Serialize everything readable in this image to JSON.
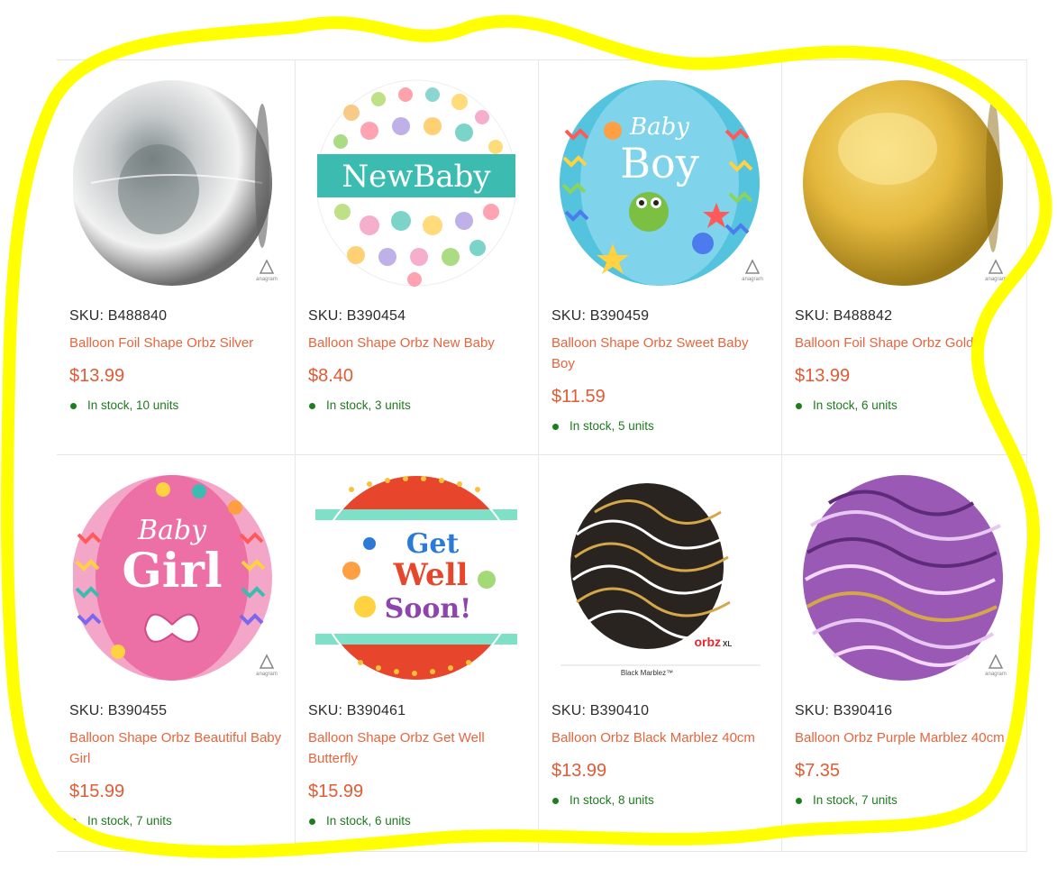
{
  "products": [
    {
      "sku": "SKU: B488840",
      "name": "Balloon Foil Shape Orbz Silver",
      "price": "$13.99",
      "stock": "In stock, 10 units",
      "image": "silver-orb-balloon"
    },
    {
      "sku": "SKU: B390454",
      "name": "Balloon Shape Orbz New Baby",
      "price": "$8.40",
      "stock": "In stock, 3 units",
      "image": "new-baby-orb-balloon",
      "banner": "NewBaby"
    },
    {
      "sku": "SKU: B390459",
      "name": "Balloon Shape Orbz Sweet Baby Boy",
      "price": "$11.59",
      "stock": "In stock, 5 units",
      "image": "baby-boy-orb-balloon",
      "lines": [
        "Baby",
        "Boy"
      ]
    },
    {
      "sku": "SKU: B488842",
      "name": "Balloon Foil Shape Orbz Gold",
      "price": "$13.99",
      "stock": "In stock, 6 units",
      "image": "gold-orb-balloon"
    },
    {
      "sku": "SKU: B390455",
      "name": "Balloon Shape Orbz Beautiful Baby Girl",
      "price": "$15.99",
      "stock": "In stock, 7 units",
      "image": "baby-girl-orb-balloon",
      "lines": [
        "Baby",
        "Girl"
      ]
    },
    {
      "sku": "SKU: B390461",
      "name": "Balloon Shape Orbz Get Well Butterfly",
      "price": "$15.99",
      "stock": "In stock, 6 units",
      "image": "get-well-orb-balloon",
      "lines": [
        "Get",
        "Well",
        "Soon!"
      ]
    },
    {
      "sku": "SKU: B390410",
      "name": "Balloon Orbz Black Marblez 40cm",
      "price": "$13.99",
      "stock": "In stock, 8 units",
      "image": "black-marblez-orb-balloon",
      "brand": "orbz",
      "brand_suffix": "XL",
      "caption": "Black Marblez™"
    },
    {
      "sku": "SKU: B390416",
      "name": "Balloon Orbz Purple Marblez 40cm",
      "price": "$7.35",
      "stock": "In stock, 7 units",
      "image": "purple-marblez-orb-balloon"
    }
  ],
  "anagram_logo": "anagram",
  "colors": {
    "link": "#e8643c",
    "price": "#e15b34",
    "stock": "#1f7a1f",
    "highlight": "#ffff00"
  }
}
